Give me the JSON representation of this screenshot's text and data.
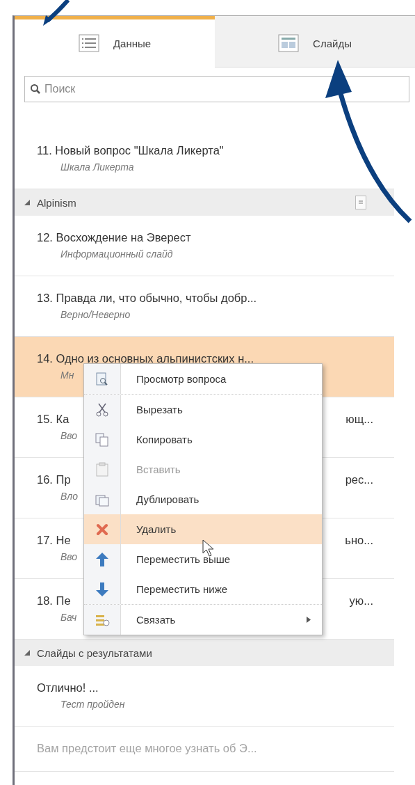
{
  "tabs": [
    {
      "label": "Данные",
      "selected": true
    },
    {
      "label": "Слайды",
      "selected": false
    }
  ],
  "search": {
    "placeholder": "Поиск"
  },
  "list": [
    {
      "kind": "item",
      "title": "11. Новый вопрос \"Шкала Ликерта\"",
      "subtitle": "Шкала Ликерта",
      "selected": false,
      "dimmed": false
    },
    {
      "kind": "group",
      "label": "Alpinism",
      "expanded": true,
      "menu_button": true
    },
    {
      "kind": "item",
      "title": "12. Восхождение на Эверест",
      "subtitle": "Информационный слайд",
      "selected": false,
      "dimmed": false
    },
    {
      "kind": "item",
      "title": "13. Правда ли, что обычно, чтобы добр...",
      "subtitle": "Верно/Неверно",
      "selected": false,
      "dimmed": false
    },
    {
      "kind": "item",
      "title": "14. Одно из основных альпинистских н...",
      "subtitle": "Мн",
      "selected": true,
      "dimmed": false
    },
    {
      "kind": "item",
      "title": "15. Ка",
      "title_tail": "ющ...",
      "subtitle": "Вво",
      "selected": false,
      "dimmed": false
    },
    {
      "kind": "item",
      "title": "16. Пр",
      "title_tail": "рес...",
      "subtitle": "Вло",
      "selected": false,
      "dimmed": false
    },
    {
      "kind": "item",
      "title": "17. Не",
      "title_tail": "ьно...",
      "subtitle": "Вво",
      "selected": false,
      "dimmed": false
    },
    {
      "kind": "item",
      "title": "18. Пе",
      "title_tail": "ую...",
      "subtitle": "Бач",
      "selected": false,
      "dimmed": false
    },
    {
      "kind": "group",
      "label": "Слайды с результатами",
      "expanded": true
    },
    {
      "kind": "item",
      "title": "Отлично! ...",
      "subtitle": "Тест пройден",
      "selected": false,
      "dimmed": false
    },
    {
      "kind": "item",
      "title": "Вам предстоит еще многое узнать об Э...",
      "selected": false,
      "dimmed": true
    }
  ],
  "context_menu": [
    {
      "label": "Просмотр вопроса",
      "selected": false,
      "disabled": false,
      "separator": true
    },
    {
      "label": "Вырезать",
      "selected": false,
      "disabled": false
    },
    {
      "label": "Копировать",
      "selected": false,
      "disabled": false
    },
    {
      "label": "Вставить",
      "selected": false,
      "disabled": true
    },
    {
      "label": "Дублировать",
      "selected": false,
      "disabled": false
    },
    {
      "label": "Удалить",
      "selected": true,
      "disabled": false
    },
    {
      "label": "Переместить выше",
      "selected": false,
      "disabled": false
    },
    {
      "label": "Переместить ниже",
      "selected": false,
      "disabled": false,
      "separator": true
    },
    {
      "label": "Связать",
      "selected": false,
      "disabled": false,
      "submenu": true
    }
  ]
}
